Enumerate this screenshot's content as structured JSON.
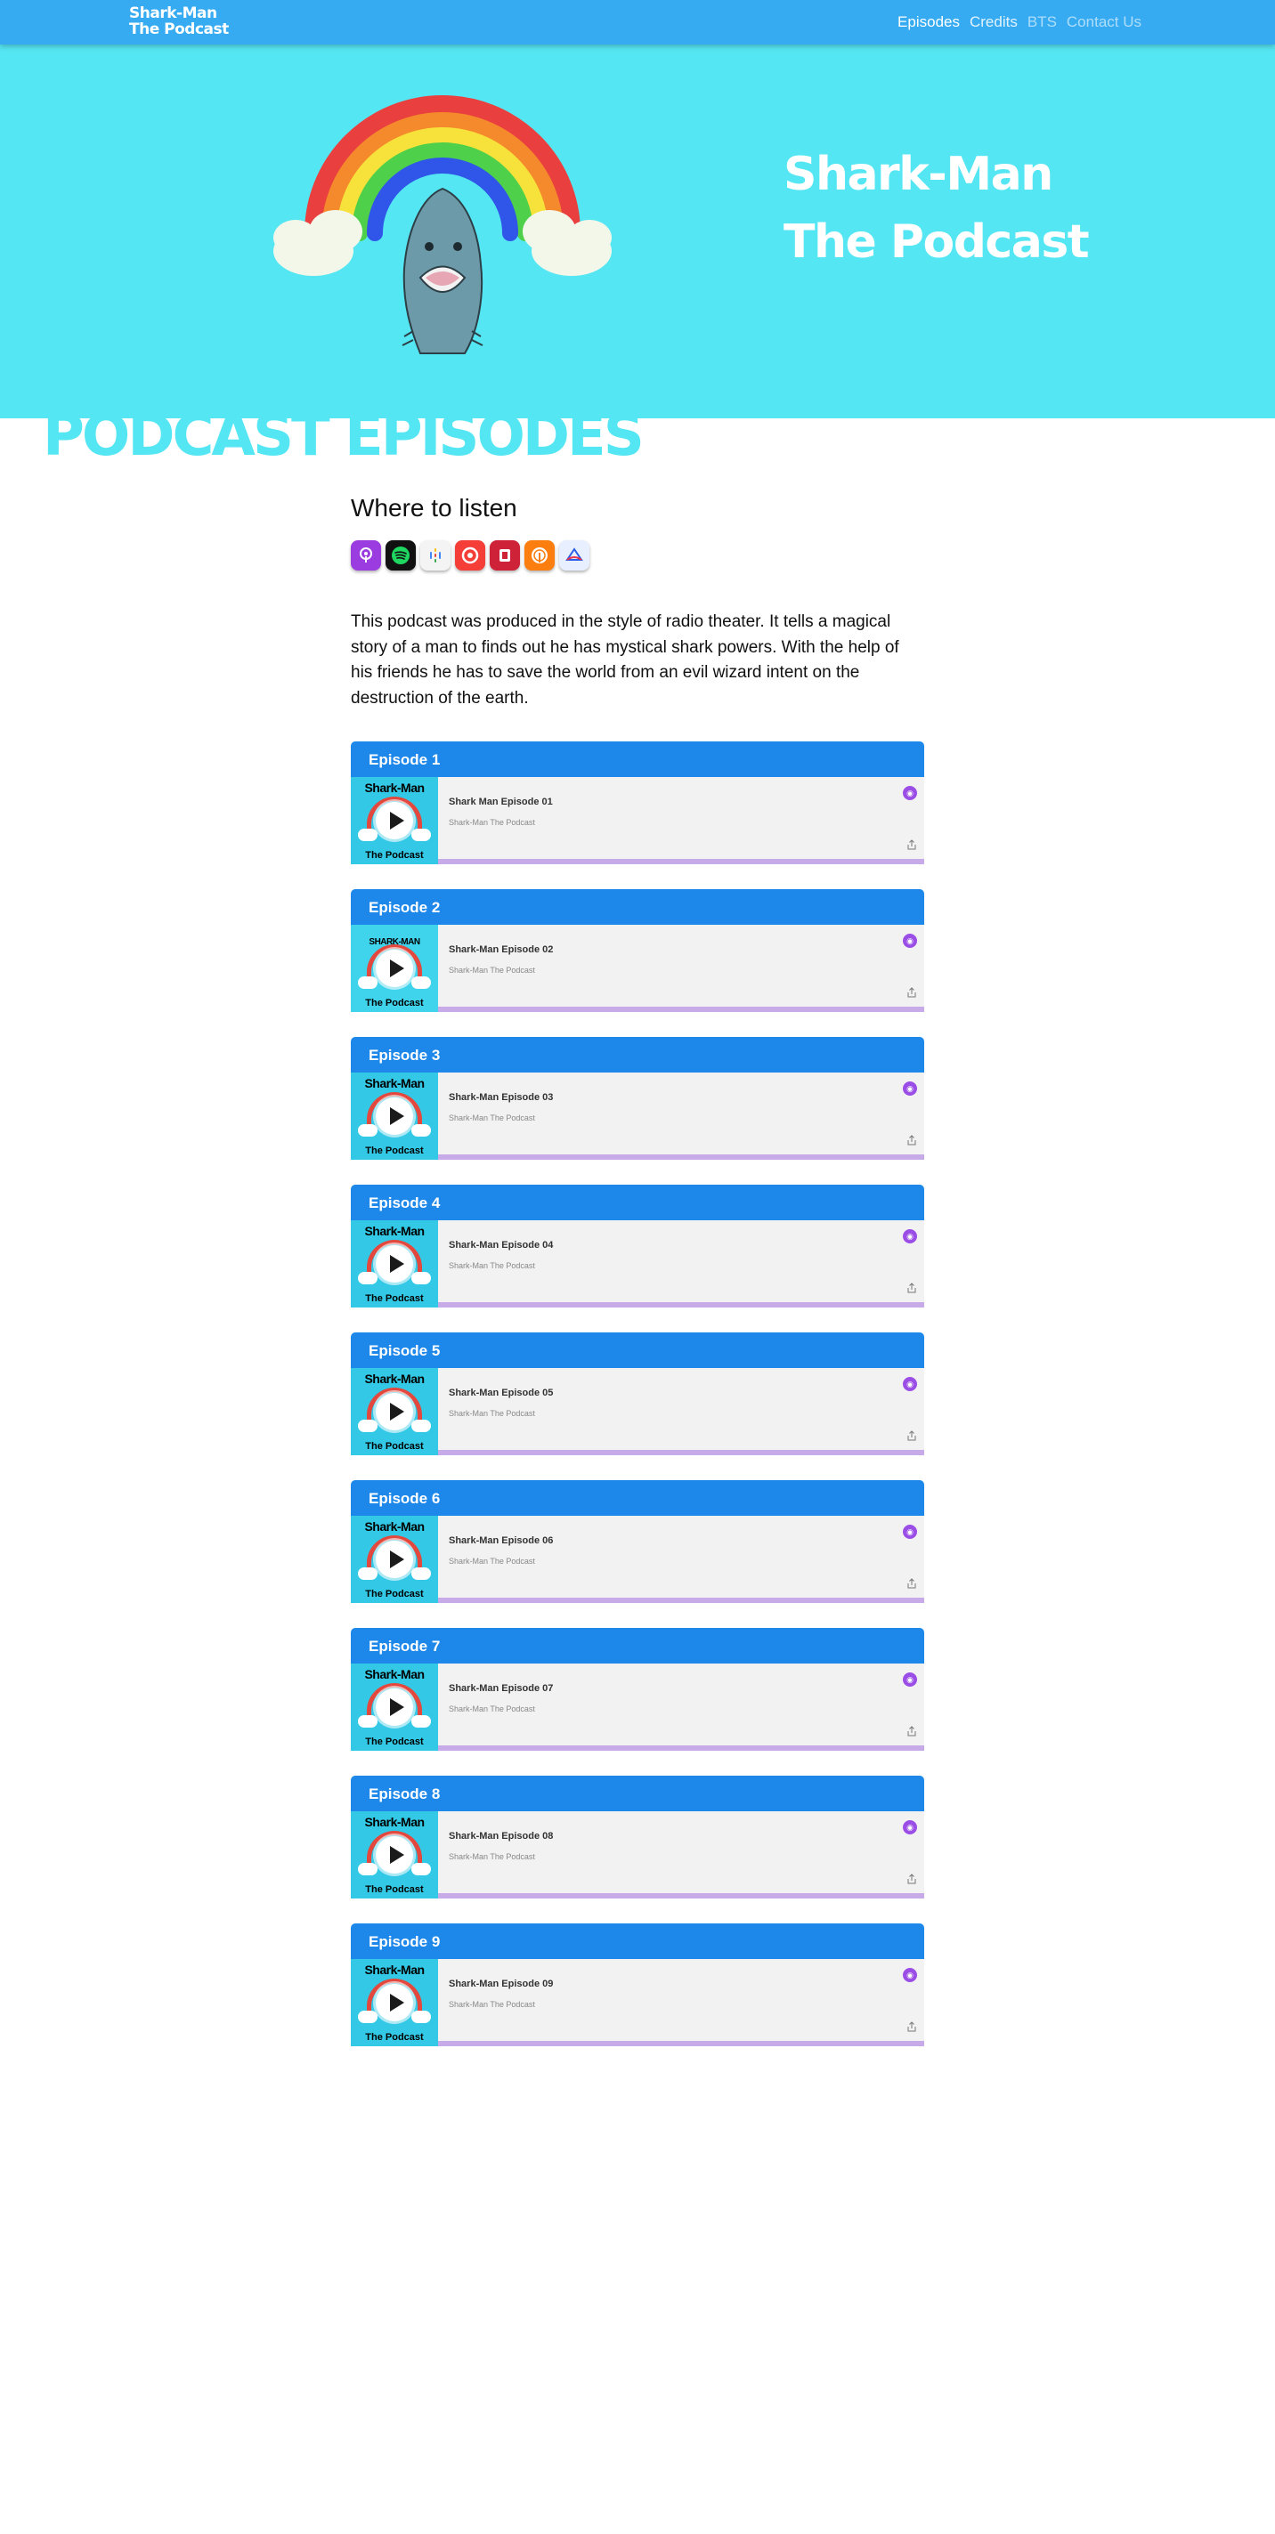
{
  "brand": {
    "line1": "Shark-Man",
    "line2": "The Podcast"
  },
  "nav": {
    "items": [
      {
        "label": "Episodes",
        "state": "active"
      },
      {
        "label": "Credits",
        "state": "semi"
      },
      {
        "label": "BTS",
        "state": "muted"
      },
      {
        "label": "Contact Us",
        "state": "muted"
      }
    ]
  },
  "hero": {
    "title_line1": "Shark-Man",
    "title_line2": "The Podcast"
  },
  "section": {
    "title": "PODCAST EPISODES"
  },
  "listen": {
    "title": "Where to listen",
    "icons": [
      {
        "name": "apple-podcasts-icon",
        "color": "#9b3ce0",
        "glyph": "◉"
      },
      {
        "name": "spotify-icon",
        "color": "#111111",
        "glyph": "≋"
      },
      {
        "name": "google-podcasts-icon",
        "color": "#f4f4f4",
        "glyph": "⁞"
      },
      {
        "name": "pocket-casts-icon",
        "color": "#f43e37",
        "glyph": "◔"
      },
      {
        "name": "radiopublic-icon",
        "color": "#ce2238",
        "glyph": "▯"
      },
      {
        "name": "overcast-icon",
        "color": "#fc7e0f",
        "glyph": "⊛"
      },
      {
        "name": "castbox-icon",
        "color": "#e8f0ff",
        "glyph": "⟁"
      }
    ]
  },
  "description": "This podcast was produced in the style of radio theater. It tells a magical story of a man to finds out he has mystical shark powers. With the help of his friends he has to save the world from an evil wizard intent on the destruction of the earth.",
  "episodes": [
    {
      "label": "Episode 1",
      "title": "Shark Man Episode 01",
      "show": "Shark-Man The Podcast",
      "art_title": "Shark-Man",
      "art_sub": "The Podcast"
    },
    {
      "label": "Episode 2",
      "title": "Shark-Man Episode 02",
      "show": "Shark-Man The Podcast",
      "art_title": "SHARK-MAN",
      "art_sub": "The Podcast"
    },
    {
      "label": "Episode 3",
      "title": "Shark-Man Episode 03",
      "show": "Shark-Man The Podcast",
      "art_title": "Shark-Man",
      "art_sub": "The Podcast"
    },
    {
      "label": "Episode 4",
      "title": "Shark-Man Episode 04",
      "show": "Shark-Man The Podcast",
      "art_title": "Shark-Man",
      "art_sub": "The Podcast"
    },
    {
      "label": "Episode 5",
      "title": "Shark-Man Episode 05",
      "show": "Shark-Man The Podcast",
      "art_title": "Shark-Man",
      "art_sub": "The Podcast"
    },
    {
      "label": "Episode 6",
      "title": "Shark-Man Episode 06",
      "show": "Shark-Man The Podcast",
      "art_title": "Shark-Man",
      "art_sub": "The Podcast"
    },
    {
      "label": "Episode 7",
      "title": "Shark-Man Episode 07",
      "show": "Shark-Man The Podcast",
      "art_title": "Shark-Man",
      "art_sub": "The Podcast"
    },
    {
      "label": "Episode 8",
      "title": "Shark-Man Episode 08",
      "show": "Shark-Man The Podcast",
      "art_title": "Shark-Man",
      "art_sub": "The Podcast"
    },
    {
      "label": "Episode 9",
      "title": "Shark-Man Episode 09",
      "show": "Shark-Man The Podcast",
      "art_title": "Shark-Man",
      "art_sub": "The Podcast"
    }
  ],
  "colors": {
    "navbar": "#36abf2",
    "hero": "#55e6f3",
    "episode_header": "#1e88ea",
    "player_progress": "#c7abe9",
    "podcast_badge": "#9b4ee6"
  }
}
